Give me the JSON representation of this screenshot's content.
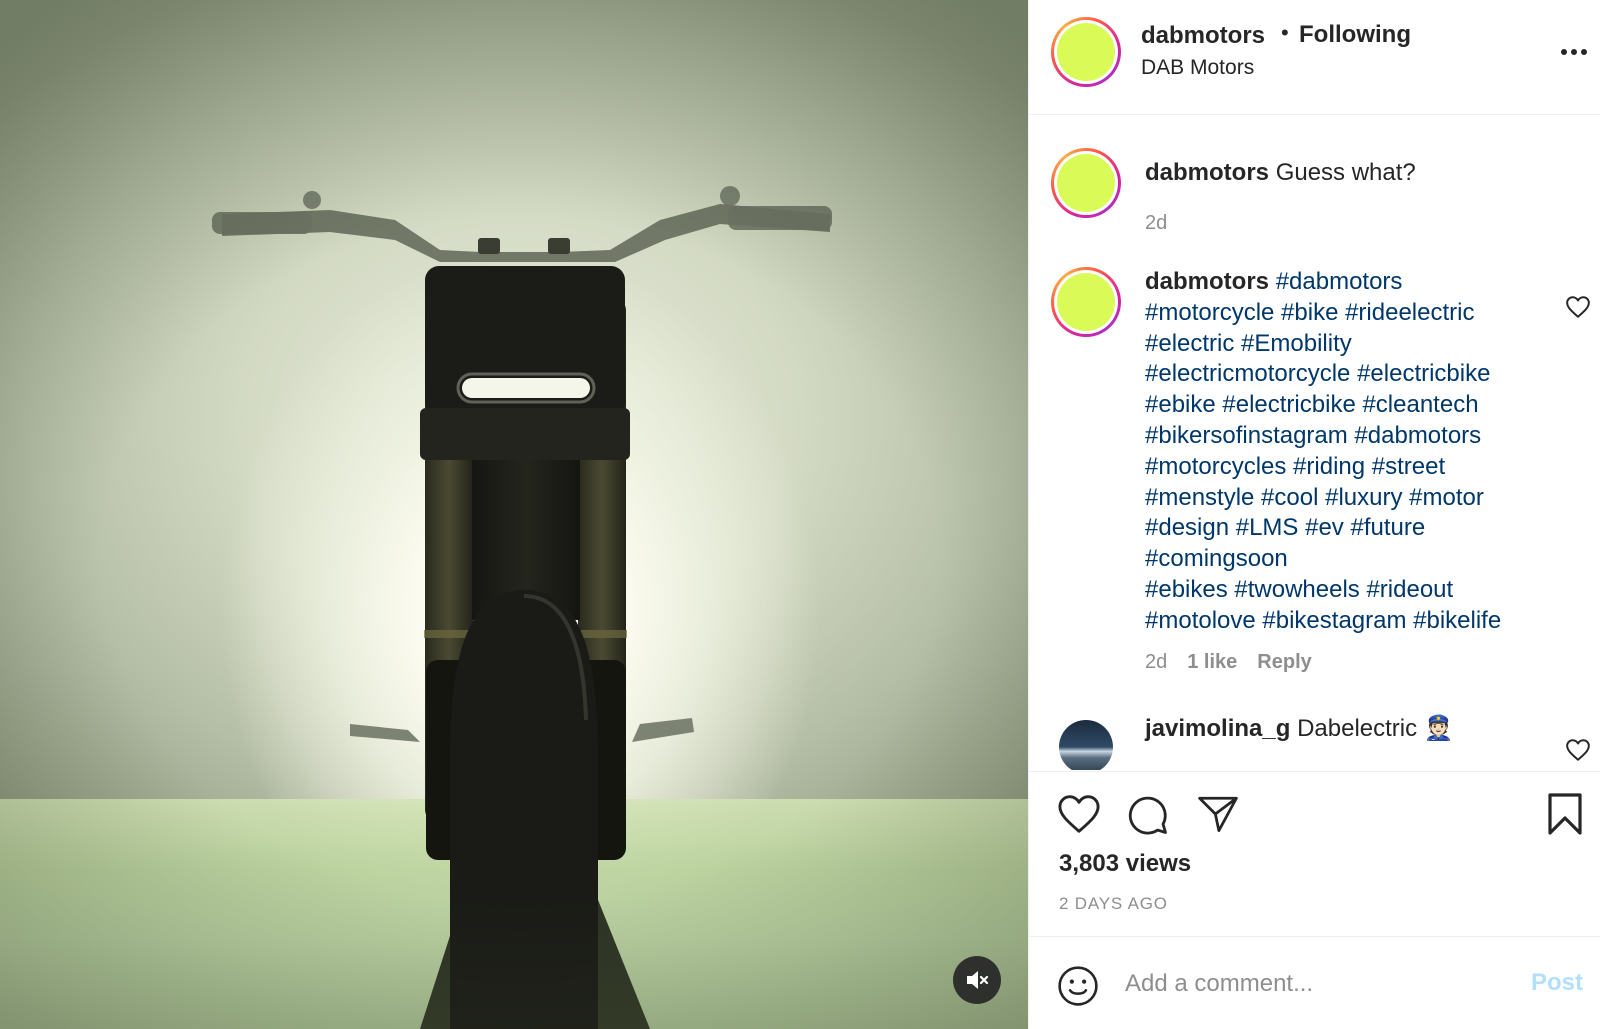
{
  "post": {
    "header": {
      "username": "dabmotors",
      "separator": "•",
      "follow_status": "Following",
      "full_name": "DAB Motors"
    },
    "caption": {
      "username": "dabmotors",
      "text": "Guess what?",
      "time": "2d"
    },
    "hashtag_comment": {
      "username": "dabmotors",
      "lines": [
        "#dabmotors",
        "#motorcycle #bike #rideelectric",
        "#electric #Emobility",
        "#electricmotorcycle #electricbike",
        "#ebike #electricbike #cleantech",
        "#bikersofinstagram #dabmotors",
        "#motorcycles #riding #street",
        "#menstyle #cool #luxury #motor",
        "#design #LMS #ev #future",
        "#comingsoon",
        "#ebikes #twowheels #rideout",
        "#motolove #bikestagram #bikelife"
      ],
      "time": "2d",
      "likes": "1 like",
      "reply_label": "Reply"
    },
    "reply_comment": {
      "username": "javimolina_g",
      "text": "Dabelectric",
      "emoji": "👮🏻"
    },
    "stats": {
      "views": "3,803 views",
      "posted_ago": "2 DAYS AGO"
    },
    "comment_box": {
      "placeholder": "Add a comment...",
      "post_label": "Post"
    }
  },
  "colors": {
    "avatar_fill": "#d9fa57",
    "hashtag": "#00376b",
    "post_button": "#b2dffc",
    "secondary_text": "#8e8e8e"
  },
  "icons": {
    "more": "more-options-icon",
    "like": "heart-icon",
    "comment": "comment-bubble-icon",
    "share": "paper-plane-icon",
    "save": "bookmark-icon",
    "emoji": "smiley-icon",
    "mute": "speaker-muted-icon"
  }
}
